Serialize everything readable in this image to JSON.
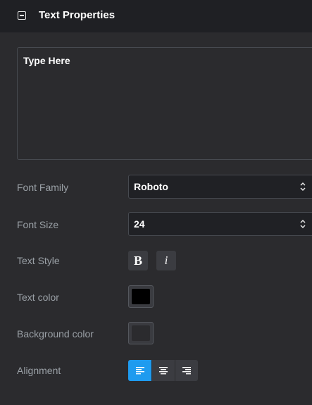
{
  "header": {
    "title": "Text Properties",
    "collapse_icon": "collapse-minus-icon"
  },
  "text_input": {
    "value": "Type Here"
  },
  "font_family": {
    "label": "Font Family",
    "value": "Roboto"
  },
  "font_size": {
    "label": "Font Size",
    "value": "24"
  },
  "text_style": {
    "label": "Text Style",
    "bold": "B",
    "italic": "i"
  },
  "text_color": {
    "label": "Text color",
    "color": "#000000"
  },
  "background_color": {
    "label": "Background color",
    "color": "#2b2b2e"
  },
  "alignment": {
    "label": "Alignment",
    "selected": "left",
    "options": [
      "left",
      "center",
      "right"
    ]
  },
  "colors": {
    "accent": "#1e9bef",
    "panel": "#2b2b2e",
    "header": "#1f2024"
  }
}
